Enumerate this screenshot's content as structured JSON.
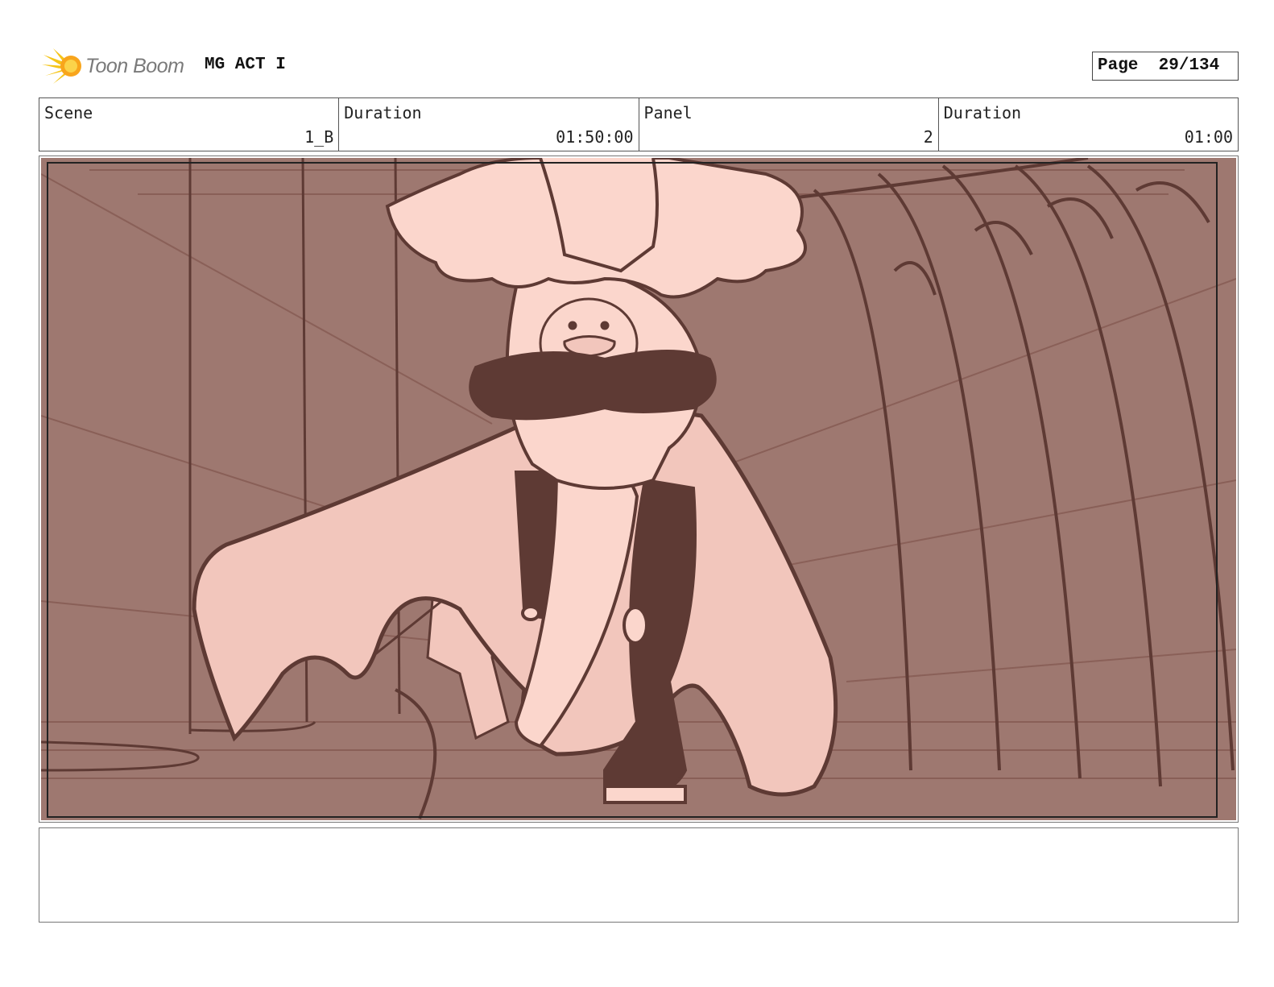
{
  "header": {
    "logo_text": "Toon Boom",
    "project_title": "MG ACT I",
    "page_label": "Page",
    "page_number": "29/134"
  },
  "info": {
    "scene_label": "Scene",
    "scene_value": "1_B",
    "duration_label": "Duration",
    "duration_value": "01:50:00",
    "panel_label": "Panel",
    "panel_value": "2",
    "panel_duration_label": "Duration",
    "panel_duration_value": "01:00"
  },
  "colors": {
    "background_wall": "#9e7870",
    "line_dark": "#5e3a34",
    "skin_light": "#fbd6cc",
    "cloak": "#f2c6bc",
    "logo_yellow": "#f5c518"
  },
  "notes": {
    "text": ""
  }
}
